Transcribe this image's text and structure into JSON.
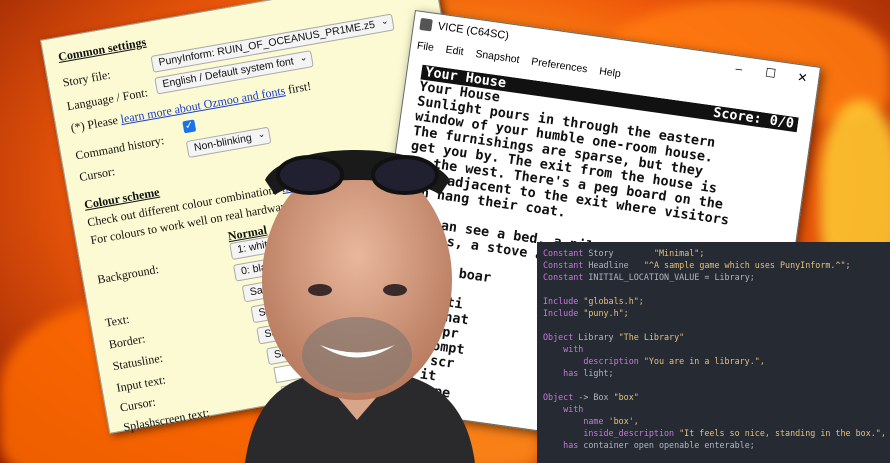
{
  "settings": {
    "common_heading": "Common settings",
    "story_label": "Story file:",
    "story_value": "PunyInform: RUIN_OF_OCEANUS_PR1ME.z5",
    "language_label": "Language / Font:",
    "language_value": "English / Default system font",
    "please_prefix": "(*) Please ",
    "please_link": "learn more about Ozmoo and fonts",
    "please_suffix": " first!",
    "history_label": "Command history:",
    "cursor_label": "Cursor:",
    "cursor_value": "Non-blinking",
    "colour_heading": "Colour scheme",
    "colour_check_prefix": "Check out different colour combinations ",
    "colour_check_link": "here",
    "colour_hw_text": "For colours to work well on real hardware, use",
    "normal_heading": "Normal",
    "rows": [
      {
        "label": "Background:",
        "value": "1: white"
      },
      {
        "label": "",
        "value": "0: black"
      },
      {
        "label": "Text:",
        "value": "Same as background"
      },
      {
        "label": "Border:",
        "value": "Same as text"
      },
      {
        "label": "Statusline:",
        "value": "Same as text"
      },
      {
        "label": "Input text:",
        "value": "Same as text"
      },
      {
        "label": "Cursor:",
        "value": ""
      },
      {
        "label": "Splashscreen text:",
        "value": ""
      }
    ]
  },
  "vice": {
    "title": "VICE (C64SC)",
    "menu": [
      "File",
      "Edit",
      "Snapshot",
      "Preferences",
      "Help"
    ],
    "location": "Your House",
    "score": "Score: 0/0",
    "lines": [
      "Your House",
      "Sunlight pours in through the eastern",
      "window of your humble one-room house.",
      "The furnishings are sparse, but they",
      "get you by. The exit from the house is",
      "to the west. There's a peg board on the",
      "wall adjacent to the exit where visitors",
      "can hang their coat.",
      "",
      "You can see a bed, a pile of",
      "clothes, a stove and",
      "",
      "the peg boar",
      "",
      "descripti",
      "e and what",
      "is the pr",
      "the prompt",
      "ption scr",
      "resh it",
      "now. Type"
    ]
  },
  "code": [
    [
      {
        "t": "Constant ",
        "c": "kw"
      },
      {
        "t": "Story        ",
        "c": "id"
      },
      {
        "t": "\"Minimal\";",
        "c": "str"
      }
    ],
    [
      {
        "t": "Constant ",
        "c": "kw"
      },
      {
        "t": "Headline   ",
        "c": "id"
      },
      {
        "t": "\"^A sample game which uses PunyInform.^\";",
        "c": "str"
      }
    ],
    [
      {
        "t": "Constant ",
        "c": "kw"
      },
      {
        "t": "INITIAL_LOCATION_VALUE = Library;",
        "c": "id"
      }
    ],
    [],
    [
      {
        "t": "Include ",
        "c": "kw"
      },
      {
        "t": "\"globals.h\";",
        "c": "str"
      }
    ],
    [
      {
        "t": "Include ",
        "c": "kw"
      },
      {
        "t": "\"puny.h\";",
        "c": "str"
      }
    ],
    [],
    [
      {
        "t": "Object ",
        "c": "kw"
      },
      {
        "t": "Library ",
        "c": "id"
      },
      {
        "t": "\"The Library\"",
        "c": "str"
      }
    ],
    [
      {
        "t": "    with",
        "c": "kw"
      }
    ],
    [
      {
        "t": "        description ",
        "c": "kw"
      },
      {
        "t": "\"You are in a library.\",",
        "c": "str"
      }
    ],
    [
      {
        "t": "    has ",
        "c": "kw"
      },
      {
        "t": "light;",
        "c": "id"
      }
    ],
    [],
    [
      {
        "t": "Object ",
        "c": "kw"
      },
      {
        "t": "-> Box ",
        "c": "id"
      },
      {
        "t": "\"box\"",
        "c": "str"
      }
    ],
    [
      {
        "t": "    with",
        "c": "kw"
      }
    ],
    [
      {
        "t": "        name ",
        "c": "kw"
      },
      {
        "t": "'box',",
        "c": "str"
      }
    ],
    [
      {
        "t": "        inside_description ",
        "c": "kw"
      },
      {
        "t": "\"It feels so nice, standing in the box.\",",
        "c": "str"
      }
    ],
    [
      {
        "t": "    has ",
        "c": "kw"
      },
      {
        "t": "container open openable enterable;",
        "c": "id"
      }
    ]
  ],
  "colors": {
    "fire": "#f05a0a",
    "paper": "#fbfad2",
    "code_bg": "#262a33",
    "link": "#1a3cc8"
  }
}
